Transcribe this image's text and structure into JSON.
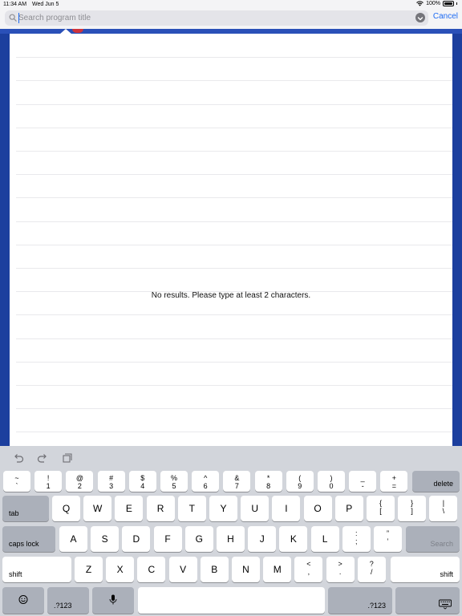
{
  "status": {
    "time": "11:34 AM",
    "date": "Wed Jun 5",
    "battery": "100%"
  },
  "search": {
    "placeholder": "Search program title",
    "value": "",
    "cancel_label": "Cancel"
  },
  "results": {
    "empty_message": "No results. Please type at least 2 characters."
  },
  "keyboard": {
    "row1": [
      {
        "top": "~",
        "bot": "`"
      },
      {
        "top": "!",
        "bot": "1"
      },
      {
        "top": "@",
        "bot": "2"
      },
      {
        "top": "#",
        "bot": "3"
      },
      {
        "top": "$",
        "bot": "4"
      },
      {
        "top": "%",
        "bot": "5"
      },
      {
        "top": "^",
        "bot": "6"
      },
      {
        "top": "&",
        "bot": "7"
      },
      {
        "top": "*",
        "bot": "8"
      },
      {
        "top": "(",
        "bot": "9"
      },
      {
        "top": ")",
        "bot": "0"
      },
      {
        "top": "_",
        "bot": "-"
      },
      {
        "top": "+",
        "bot": "="
      }
    ],
    "delete_label": "delete",
    "tab_label": "tab",
    "row2": [
      "Q",
      "W",
      "E",
      "R",
      "T",
      "Y",
      "U",
      "I",
      "O",
      "P"
    ],
    "row2_symbols": [
      {
        "top": "{",
        "bot": "["
      },
      {
        "top": "}",
        "bot": "]"
      },
      {
        "top": "|",
        "bot": "\\"
      }
    ],
    "caps_label": "caps lock",
    "row3": [
      "A",
      "S",
      "D",
      "F",
      "G",
      "H",
      "J",
      "K",
      "L"
    ],
    "row3_symbols": [
      {
        "top": ":",
        "bot": ";"
      },
      {
        "top": "”",
        "bot": "’"
      }
    ],
    "search_key_label": "Search",
    "shift_label": "shift",
    "row4": [
      "Z",
      "X",
      "C",
      "V",
      "B",
      "N",
      "M"
    ],
    "row4_symbols": [
      {
        "top": "<",
        "bot": ","
      },
      {
        "top": ">",
        "bot": "."
      },
      {
        "top": "?",
        "bot": "/"
      }
    ],
    "numbers_label": ".?123"
  }
}
